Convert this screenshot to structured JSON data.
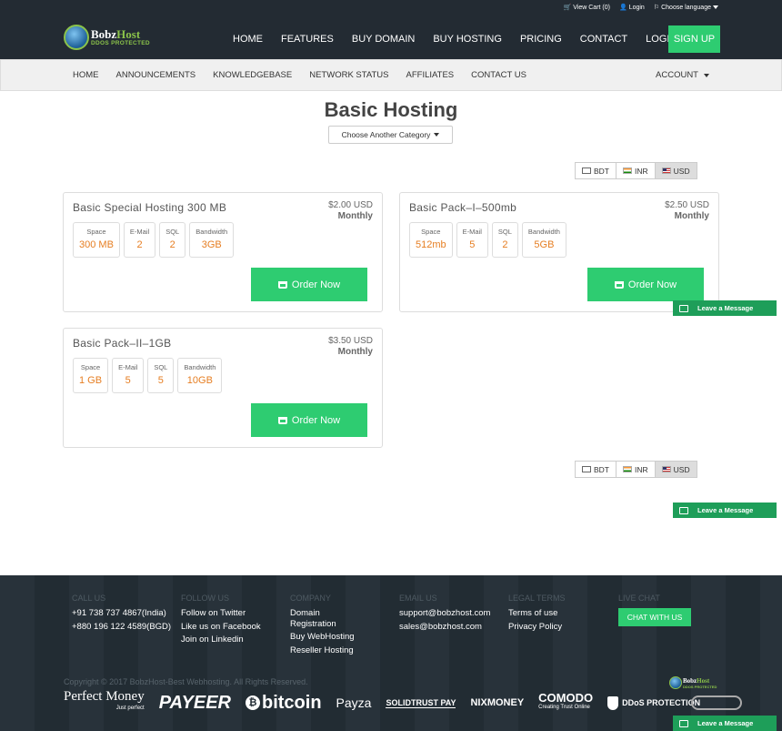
{
  "top_links": {
    "cart": "View Cart (0)",
    "login": "Login",
    "language": "Choose language"
  },
  "logo": {
    "brand_a": "Bobz",
    "brand_b": "Host",
    "tagline": "DDOS PROTECTED"
  },
  "main_nav": [
    "HOME",
    "FEATURES",
    "BUY DOMAIN",
    "BUY HOSTING",
    "PRICING",
    "CONTACT",
    "LOGIN"
  ],
  "signup_label": "SIGN UP",
  "sub_nav": [
    "HOME",
    "ANNOUNCEMENTS",
    "KNOWLEDGEBASE",
    "NETWORK STATUS",
    "AFFILIATES",
    "CONTACT US"
  ],
  "account_label": "ACCOUNT",
  "page_title": "Basic Hosting",
  "category_button": "Choose Another Category",
  "currencies": [
    {
      "code": "BDT",
      "flag": "bd",
      "active": false
    },
    {
      "code": "INR",
      "flag": "in",
      "active": false
    },
    {
      "code": "USD",
      "flag": "us",
      "active": true
    }
  ],
  "products": [
    {
      "name": "Basic Special Hosting 300 MB",
      "price": "$2.00 USD",
      "cycle": "Monthly",
      "specs": [
        {
          "label": "Space",
          "value": "300 MB"
        },
        {
          "label": "E-Mail",
          "value": "2"
        },
        {
          "label": "SQL",
          "value": "2"
        },
        {
          "label": "Bandwidth",
          "value": "3GB"
        }
      ],
      "order_label": "Order Now"
    },
    {
      "name": "Basic Pack–I–500mb",
      "price": "$2.50 USD",
      "cycle": "Monthly",
      "specs": [
        {
          "label": "Space",
          "value": "512mb"
        },
        {
          "label": "E-Mail",
          "value": "5"
        },
        {
          "label": "SQL",
          "value": "2"
        },
        {
          "label": "Bandwidth",
          "value": "5GB"
        }
      ],
      "order_label": "Order Now"
    },
    {
      "name": "Basic Pack–II–1GB",
      "price": "$3.50 USD",
      "cycle": "Monthly",
      "specs": [
        {
          "label": "Space",
          "value": "1 GB"
        },
        {
          "label": "E-Mail",
          "value": "5"
        },
        {
          "label": "SQL",
          "value": "5"
        },
        {
          "label": "Bandwidth",
          "value": "10GB"
        }
      ],
      "order_label": "Order Now"
    }
  ],
  "leave_message_label": "Leave a Message",
  "footer": {
    "call_us": {
      "heading": "CALL US",
      "lines": [
        "+91 738 737 4867(India)",
        "+880 196 122 4589(BGD)"
      ]
    },
    "follow_us": {
      "heading": "FOLLOW US",
      "lines": [
        "Follow on Twitter",
        "Like us on Facebook",
        "Join on Linkedin"
      ]
    },
    "company": {
      "heading": "COMPANY",
      "lines": [
        "Domain Registration",
        "Buy WebHosting",
        "Reseller Hosting"
      ]
    },
    "email_us": {
      "heading": "EMAIL US",
      "lines": [
        "support@bobzhost.com",
        "sales@bobzhost.com"
      ]
    },
    "legal_terms": {
      "heading": "LEGAL TERMS",
      "lines": [
        "Terms of use",
        "Privacy Policy"
      ]
    },
    "live_chat": {
      "heading": "LIVE CHAT",
      "button": "CHAT WITH US"
    },
    "copyright": "Copyright © 2017 BobzHost-Best Webhosting. All Rights Reserved.",
    "payments": [
      "Perfect Money",
      "PAYEER",
      "bitcoin",
      "Payza",
      "SOLIDTRUST PAY",
      "NIXMONEY",
      "COMODO",
      "DDoS PROTECTION"
    ],
    "payment_sublabels": {
      "perfect_money": "Just perfect",
      "comodo": "Creating Trust Online"
    }
  }
}
